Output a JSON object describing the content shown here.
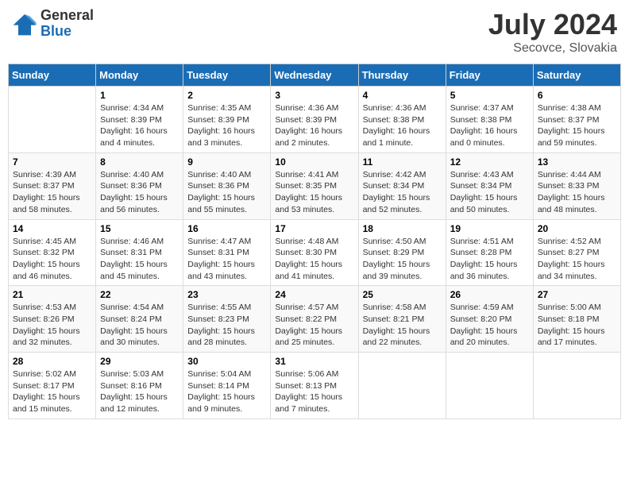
{
  "header": {
    "logo_general": "General",
    "logo_blue": "Blue",
    "month_year": "July 2024",
    "location": "Secovce, Slovakia"
  },
  "days_of_week": [
    "Sunday",
    "Monday",
    "Tuesday",
    "Wednesday",
    "Thursday",
    "Friday",
    "Saturday"
  ],
  "weeks": [
    [
      {
        "day": "",
        "info": ""
      },
      {
        "day": "1",
        "info": "Sunrise: 4:34 AM\nSunset: 8:39 PM\nDaylight: 16 hours\nand 4 minutes."
      },
      {
        "day": "2",
        "info": "Sunrise: 4:35 AM\nSunset: 8:39 PM\nDaylight: 16 hours\nand 3 minutes."
      },
      {
        "day": "3",
        "info": "Sunrise: 4:36 AM\nSunset: 8:39 PM\nDaylight: 16 hours\nand 2 minutes."
      },
      {
        "day": "4",
        "info": "Sunrise: 4:36 AM\nSunset: 8:38 PM\nDaylight: 16 hours\nand 1 minute."
      },
      {
        "day": "5",
        "info": "Sunrise: 4:37 AM\nSunset: 8:38 PM\nDaylight: 16 hours\nand 0 minutes."
      },
      {
        "day": "6",
        "info": "Sunrise: 4:38 AM\nSunset: 8:37 PM\nDaylight: 15 hours\nand 59 minutes."
      }
    ],
    [
      {
        "day": "7",
        "info": "Sunrise: 4:39 AM\nSunset: 8:37 PM\nDaylight: 15 hours\nand 58 minutes."
      },
      {
        "day": "8",
        "info": "Sunrise: 4:40 AM\nSunset: 8:36 PM\nDaylight: 15 hours\nand 56 minutes."
      },
      {
        "day": "9",
        "info": "Sunrise: 4:40 AM\nSunset: 8:36 PM\nDaylight: 15 hours\nand 55 minutes."
      },
      {
        "day": "10",
        "info": "Sunrise: 4:41 AM\nSunset: 8:35 PM\nDaylight: 15 hours\nand 53 minutes."
      },
      {
        "day": "11",
        "info": "Sunrise: 4:42 AM\nSunset: 8:34 PM\nDaylight: 15 hours\nand 52 minutes."
      },
      {
        "day": "12",
        "info": "Sunrise: 4:43 AM\nSunset: 8:34 PM\nDaylight: 15 hours\nand 50 minutes."
      },
      {
        "day": "13",
        "info": "Sunrise: 4:44 AM\nSunset: 8:33 PM\nDaylight: 15 hours\nand 48 minutes."
      }
    ],
    [
      {
        "day": "14",
        "info": "Sunrise: 4:45 AM\nSunset: 8:32 PM\nDaylight: 15 hours\nand 46 minutes."
      },
      {
        "day": "15",
        "info": "Sunrise: 4:46 AM\nSunset: 8:31 PM\nDaylight: 15 hours\nand 45 minutes."
      },
      {
        "day": "16",
        "info": "Sunrise: 4:47 AM\nSunset: 8:31 PM\nDaylight: 15 hours\nand 43 minutes."
      },
      {
        "day": "17",
        "info": "Sunrise: 4:48 AM\nSunset: 8:30 PM\nDaylight: 15 hours\nand 41 minutes."
      },
      {
        "day": "18",
        "info": "Sunrise: 4:50 AM\nSunset: 8:29 PM\nDaylight: 15 hours\nand 39 minutes."
      },
      {
        "day": "19",
        "info": "Sunrise: 4:51 AM\nSunset: 8:28 PM\nDaylight: 15 hours\nand 36 minutes."
      },
      {
        "day": "20",
        "info": "Sunrise: 4:52 AM\nSunset: 8:27 PM\nDaylight: 15 hours\nand 34 minutes."
      }
    ],
    [
      {
        "day": "21",
        "info": "Sunrise: 4:53 AM\nSunset: 8:26 PM\nDaylight: 15 hours\nand 32 minutes."
      },
      {
        "day": "22",
        "info": "Sunrise: 4:54 AM\nSunset: 8:24 PM\nDaylight: 15 hours\nand 30 minutes."
      },
      {
        "day": "23",
        "info": "Sunrise: 4:55 AM\nSunset: 8:23 PM\nDaylight: 15 hours\nand 28 minutes."
      },
      {
        "day": "24",
        "info": "Sunrise: 4:57 AM\nSunset: 8:22 PM\nDaylight: 15 hours\nand 25 minutes."
      },
      {
        "day": "25",
        "info": "Sunrise: 4:58 AM\nSunset: 8:21 PM\nDaylight: 15 hours\nand 22 minutes."
      },
      {
        "day": "26",
        "info": "Sunrise: 4:59 AM\nSunset: 8:20 PM\nDaylight: 15 hours\nand 20 minutes."
      },
      {
        "day": "27",
        "info": "Sunrise: 5:00 AM\nSunset: 8:18 PM\nDaylight: 15 hours\nand 17 minutes."
      }
    ],
    [
      {
        "day": "28",
        "info": "Sunrise: 5:02 AM\nSunset: 8:17 PM\nDaylight: 15 hours\nand 15 minutes."
      },
      {
        "day": "29",
        "info": "Sunrise: 5:03 AM\nSunset: 8:16 PM\nDaylight: 15 hours\nand 12 minutes."
      },
      {
        "day": "30",
        "info": "Sunrise: 5:04 AM\nSunset: 8:14 PM\nDaylight: 15 hours\nand 9 minutes."
      },
      {
        "day": "31",
        "info": "Sunrise: 5:06 AM\nSunset: 8:13 PM\nDaylight: 15 hours\nand 7 minutes."
      },
      {
        "day": "",
        "info": ""
      },
      {
        "day": "",
        "info": ""
      },
      {
        "day": "",
        "info": ""
      }
    ]
  ]
}
